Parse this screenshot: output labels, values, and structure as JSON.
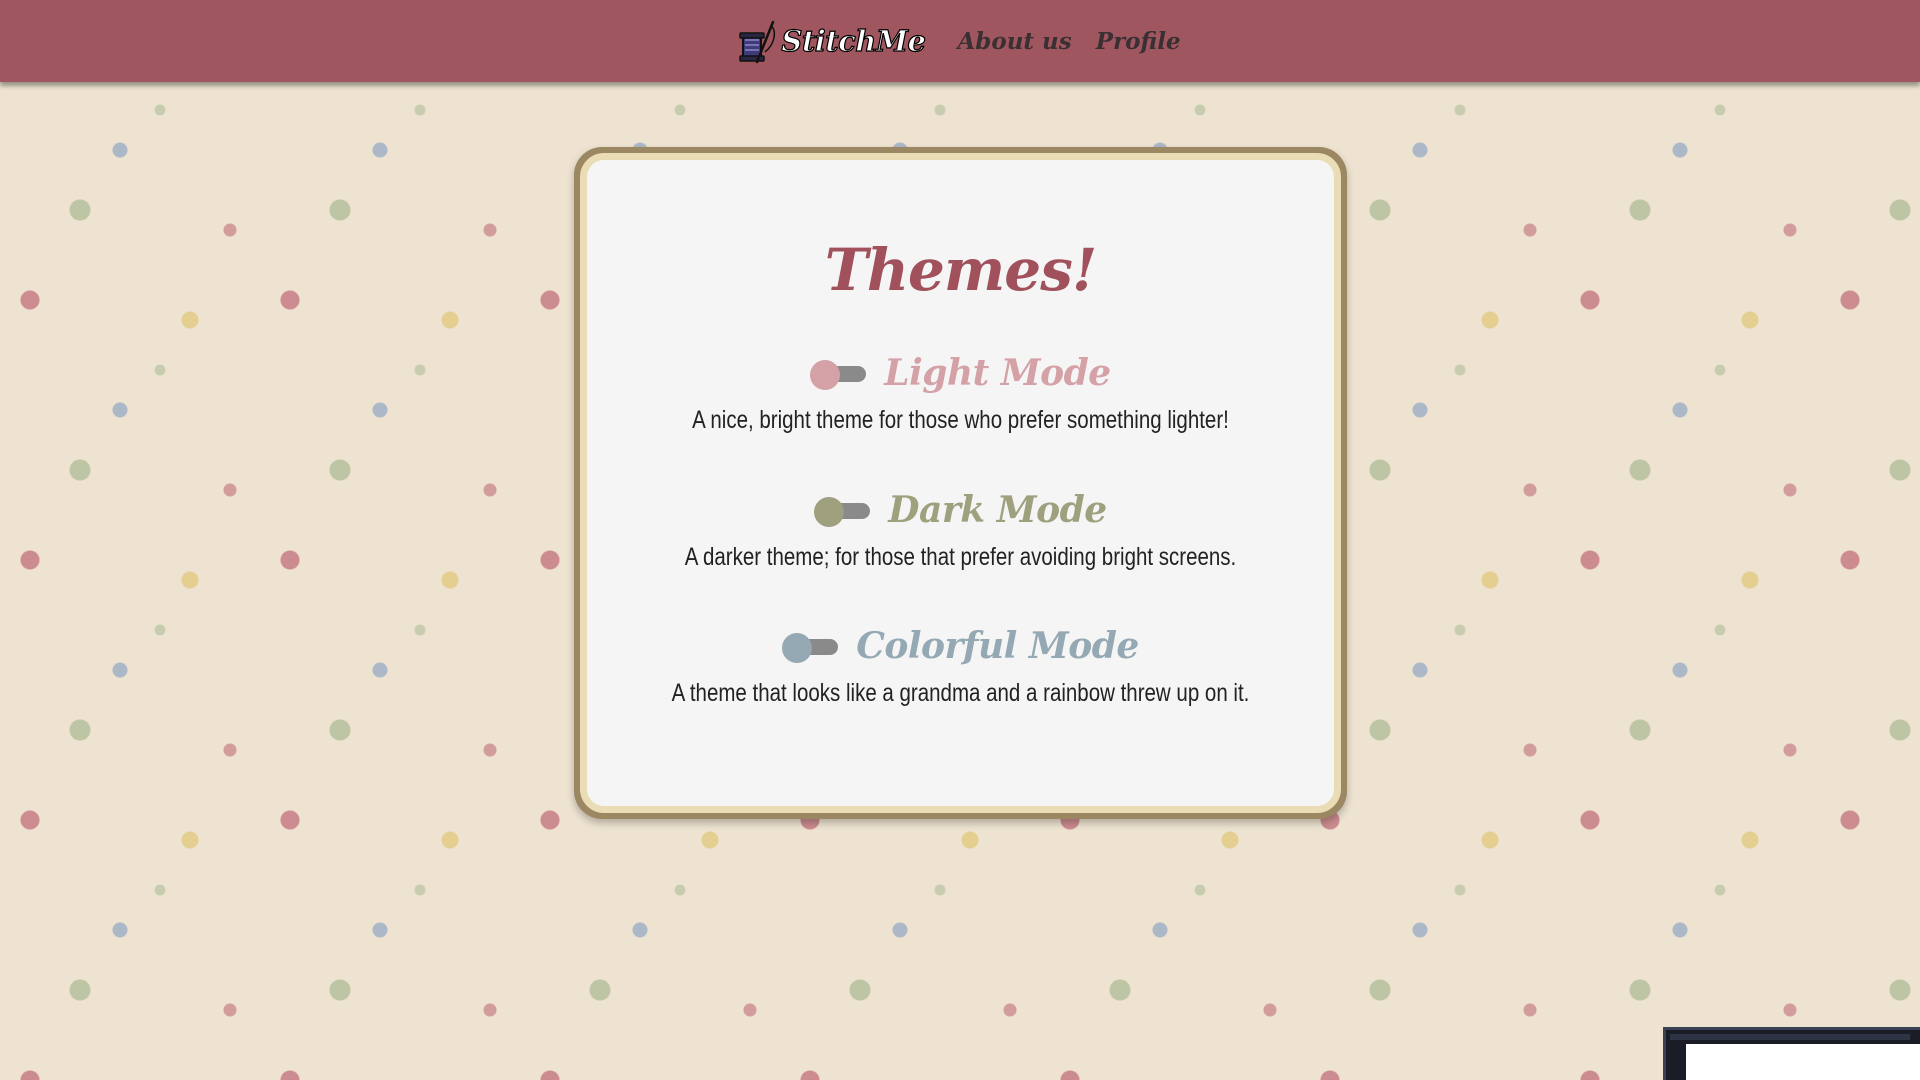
{
  "nav": {
    "brand": "StitchMe",
    "logo_icon": "thread-spool-needle-icon",
    "links": [
      "About us",
      "Profile"
    ]
  },
  "themes": {
    "title": "Themes!",
    "items": [
      {
        "name": "Light Mode",
        "description": "A nice, bright theme for those who prefer something lighter!",
        "enabled": false,
        "color": "#d4a1a6"
      },
      {
        "name": "Dark Mode",
        "description": "A darker theme; for those that prefer avoiding bright screens.",
        "enabled": false,
        "color": "#9fa07d"
      },
      {
        "name": "Colorful Mode",
        "description": "A theme that looks like a grandma and a rainbow threw up on it.",
        "enabled": false,
        "color": "#94a9b3"
      }
    ]
  },
  "colors": {
    "navbar": "#a0565f",
    "title": "#a0515b",
    "card_border": "#eadcb4",
    "card_background": "#f5f5f5",
    "page_background": "#eee3d1"
  }
}
